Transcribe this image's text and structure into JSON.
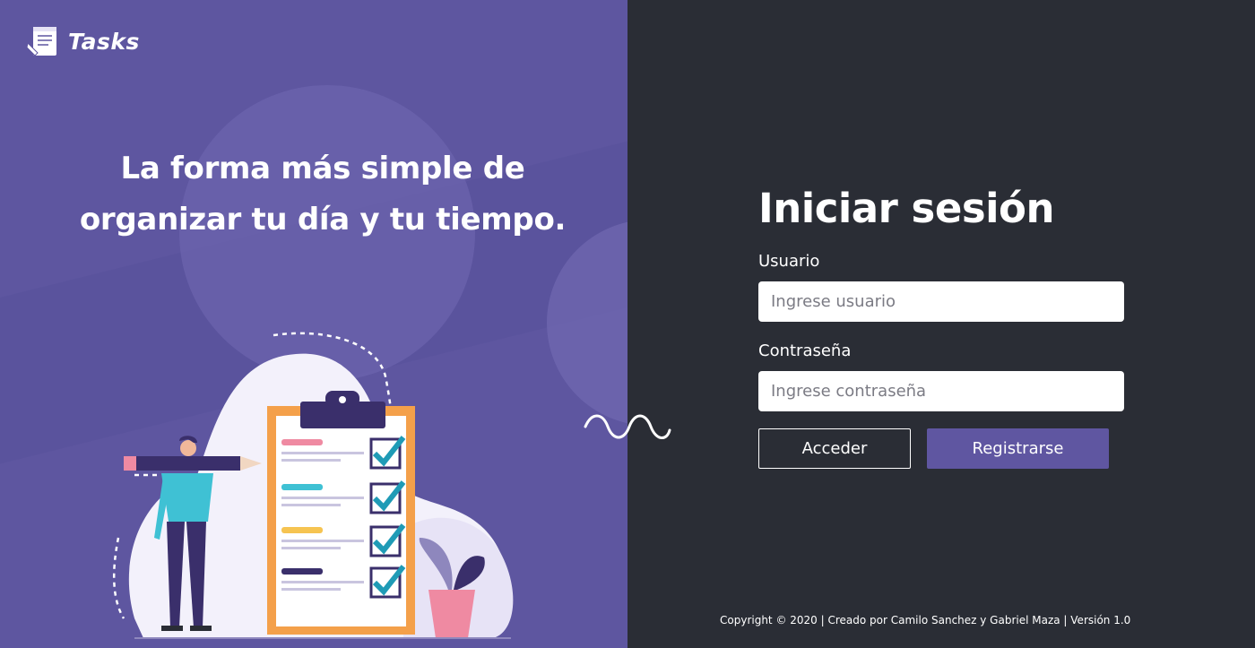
{
  "brand": {
    "name": "Tasks"
  },
  "hero": {
    "tagline_line1": "La forma más simple de",
    "tagline_line2": "organizar tu día y tu tiempo."
  },
  "login": {
    "title": "Iniciar sesión",
    "user_label": "Usuario",
    "user_placeholder": "Ingrese usuario",
    "password_label": "Contraseña",
    "password_placeholder": "Ingrese contraseña",
    "login_button": "Acceder",
    "register_button": "Registrarse"
  },
  "footer": {
    "text": "Copyright © 2020 | Creado por Camilo Sanchez y Gabriel Maza | Versión 1.0"
  },
  "colors": {
    "left_bg": "#5e56a0",
    "right_bg": "#2a2d35",
    "accent": "#5f56a1",
    "clipboard_orange": "#f4a04a",
    "check_teal": "#1f9bb6"
  },
  "icons": {
    "logo": "notepad-icon",
    "divider": "squiggle-icon"
  }
}
